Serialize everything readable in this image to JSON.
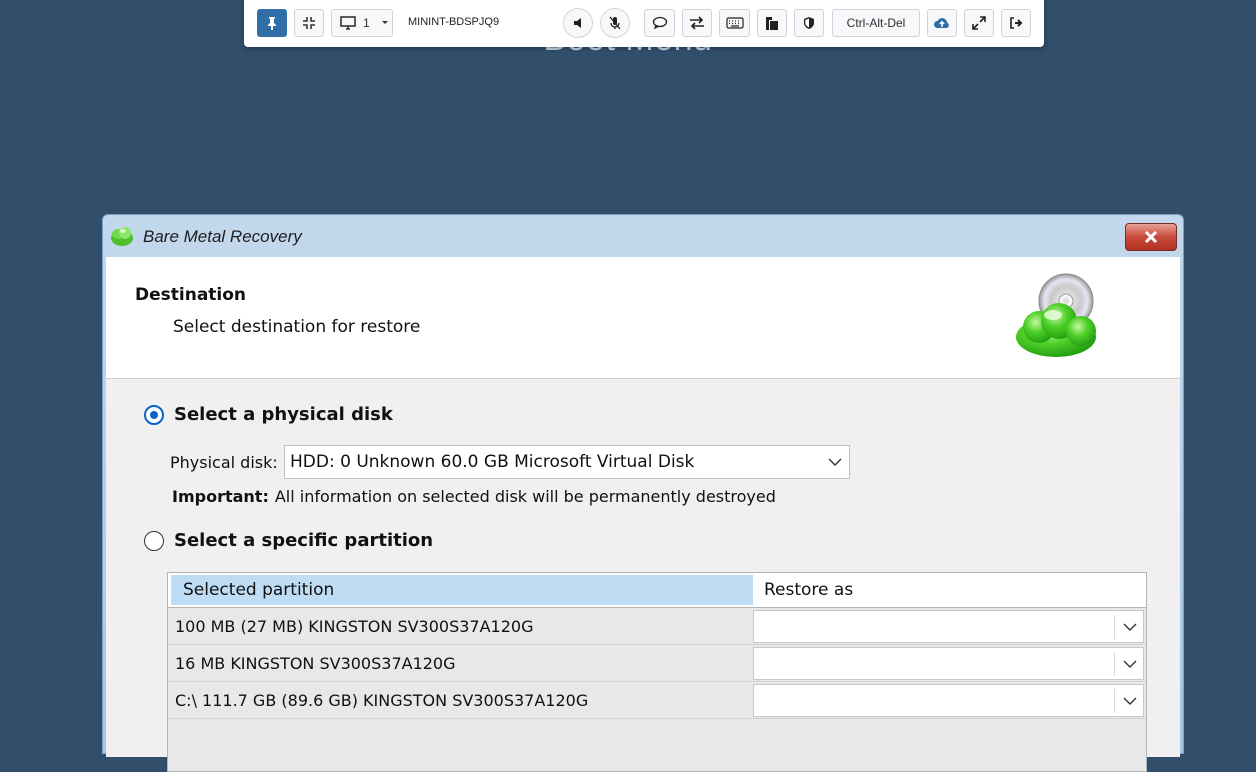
{
  "background": {
    "title": "Boot Menu"
  },
  "toolbar": {
    "monitor_label": "1",
    "hostname": "MININT-BDSPJQ9",
    "cad_label": "Ctrl-Alt-Del",
    "icons": [
      "pin-icon",
      "compress-icon",
      "monitor-icon",
      "speaker-icon",
      "mic-off-icon",
      "chat-icon",
      "transfer-icon",
      "keyboard-icon",
      "clipboard-icon",
      "shield-icon",
      "upload-cloud-icon",
      "expand-icon",
      "logout-icon"
    ]
  },
  "dialog": {
    "title": "Bare Metal Recovery",
    "header": {
      "title": "Destination",
      "subtitle": "Select destination for restore"
    },
    "option_disk": {
      "label": "Select a physical disk",
      "checked": true,
      "field_label": "Physical disk:",
      "selected_value": "HDD: 0 Unknown 60.0 GB Microsoft Virtual Disk",
      "important_label": "Important:",
      "important_text": "All information on selected disk will be permanently destroyed"
    },
    "option_partition": {
      "label": "Select a specific partition",
      "checked": false
    },
    "grid": {
      "columns": [
        "Selected partition",
        "Restore as"
      ],
      "rows": [
        {
          "partition": "100 MB (27 MB) KINGSTON SV300S37A120G",
          "restore_as": ""
        },
        {
          "partition": "16 MB KINGSTON SV300S37A120G",
          "restore_as": ""
        },
        {
          "partition": "C:\\ 111.7 GB (89.6 GB) KINGSTON SV300S37A120G",
          "restore_as": ""
        }
      ]
    }
  },
  "colors": {
    "desktop_bg": "#314e6b",
    "accent": "#2f6ea6",
    "radio_selected": "#0a64c8",
    "header_selected": "#bfdcf5"
  }
}
